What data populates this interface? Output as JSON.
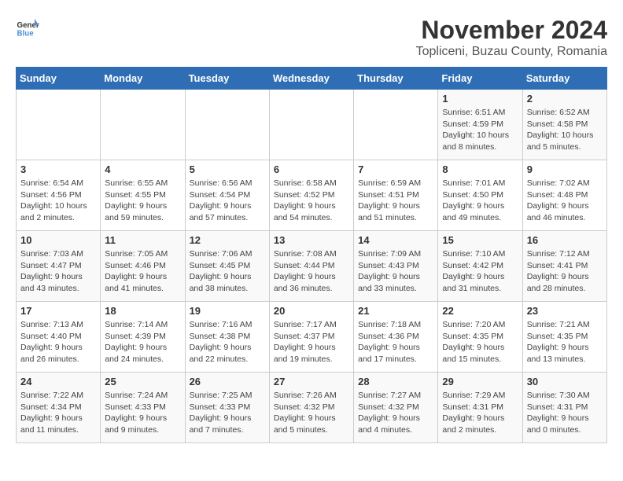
{
  "header": {
    "logo_general": "General",
    "logo_blue": "Blue",
    "month_title": "November 2024",
    "location": "Topliceni, Buzau County, Romania"
  },
  "days_of_week": [
    "Sunday",
    "Monday",
    "Tuesday",
    "Wednesday",
    "Thursday",
    "Friday",
    "Saturday"
  ],
  "weeks": [
    {
      "days": [
        {
          "number": "",
          "info": ""
        },
        {
          "number": "",
          "info": ""
        },
        {
          "number": "",
          "info": ""
        },
        {
          "number": "",
          "info": ""
        },
        {
          "number": "",
          "info": ""
        },
        {
          "number": "1",
          "info": "Sunrise: 6:51 AM\nSunset: 4:59 PM\nDaylight: 10 hours and 8 minutes."
        },
        {
          "number": "2",
          "info": "Sunrise: 6:52 AM\nSunset: 4:58 PM\nDaylight: 10 hours and 5 minutes."
        }
      ]
    },
    {
      "days": [
        {
          "number": "3",
          "info": "Sunrise: 6:54 AM\nSunset: 4:56 PM\nDaylight: 10 hours and 2 minutes."
        },
        {
          "number": "4",
          "info": "Sunrise: 6:55 AM\nSunset: 4:55 PM\nDaylight: 9 hours and 59 minutes."
        },
        {
          "number": "5",
          "info": "Sunrise: 6:56 AM\nSunset: 4:54 PM\nDaylight: 9 hours and 57 minutes."
        },
        {
          "number": "6",
          "info": "Sunrise: 6:58 AM\nSunset: 4:52 PM\nDaylight: 9 hours and 54 minutes."
        },
        {
          "number": "7",
          "info": "Sunrise: 6:59 AM\nSunset: 4:51 PM\nDaylight: 9 hours and 51 minutes."
        },
        {
          "number": "8",
          "info": "Sunrise: 7:01 AM\nSunset: 4:50 PM\nDaylight: 9 hours and 49 minutes."
        },
        {
          "number": "9",
          "info": "Sunrise: 7:02 AM\nSunset: 4:48 PM\nDaylight: 9 hours and 46 minutes."
        }
      ]
    },
    {
      "days": [
        {
          "number": "10",
          "info": "Sunrise: 7:03 AM\nSunset: 4:47 PM\nDaylight: 9 hours and 43 minutes."
        },
        {
          "number": "11",
          "info": "Sunrise: 7:05 AM\nSunset: 4:46 PM\nDaylight: 9 hours and 41 minutes."
        },
        {
          "number": "12",
          "info": "Sunrise: 7:06 AM\nSunset: 4:45 PM\nDaylight: 9 hours and 38 minutes."
        },
        {
          "number": "13",
          "info": "Sunrise: 7:08 AM\nSunset: 4:44 PM\nDaylight: 9 hours and 36 minutes."
        },
        {
          "number": "14",
          "info": "Sunrise: 7:09 AM\nSunset: 4:43 PM\nDaylight: 9 hours and 33 minutes."
        },
        {
          "number": "15",
          "info": "Sunrise: 7:10 AM\nSunset: 4:42 PM\nDaylight: 9 hours and 31 minutes."
        },
        {
          "number": "16",
          "info": "Sunrise: 7:12 AM\nSunset: 4:41 PM\nDaylight: 9 hours and 28 minutes."
        }
      ]
    },
    {
      "days": [
        {
          "number": "17",
          "info": "Sunrise: 7:13 AM\nSunset: 4:40 PM\nDaylight: 9 hours and 26 minutes."
        },
        {
          "number": "18",
          "info": "Sunrise: 7:14 AM\nSunset: 4:39 PM\nDaylight: 9 hours and 24 minutes."
        },
        {
          "number": "19",
          "info": "Sunrise: 7:16 AM\nSunset: 4:38 PM\nDaylight: 9 hours and 22 minutes."
        },
        {
          "number": "20",
          "info": "Sunrise: 7:17 AM\nSunset: 4:37 PM\nDaylight: 9 hours and 19 minutes."
        },
        {
          "number": "21",
          "info": "Sunrise: 7:18 AM\nSunset: 4:36 PM\nDaylight: 9 hours and 17 minutes."
        },
        {
          "number": "22",
          "info": "Sunrise: 7:20 AM\nSunset: 4:35 PM\nDaylight: 9 hours and 15 minutes."
        },
        {
          "number": "23",
          "info": "Sunrise: 7:21 AM\nSunset: 4:35 PM\nDaylight: 9 hours and 13 minutes."
        }
      ]
    },
    {
      "days": [
        {
          "number": "24",
          "info": "Sunrise: 7:22 AM\nSunset: 4:34 PM\nDaylight: 9 hours and 11 minutes."
        },
        {
          "number": "25",
          "info": "Sunrise: 7:24 AM\nSunset: 4:33 PM\nDaylight: 9 hours and 9 minutes."
        },
        {
          "number": "26",
          "info": "Sunrise: 7:25 AM\nSunset: 4:33 PM\nDaylight: 9 hours and 7 minutes."
        },
        {
          "number": "27",
          "info": "Sunrise: 7:26 AM\nSunset: 4:32 PM\nDaylight: 9 hours and 5 minutes."
        },
        {
          "number": "28",
          "info": "Sunrise: 7:27 AM\nSunset: 4:32 PM\nDaylight: 9 hours and 4 minutes."
        },
        {
          "number": "29",
          "info": "Sunrise: 7:29 AM\nSunset: 4:31 PM\nDaylight: 9 hours and 2 minutes."
        },
        {
          "number": "30",
          "info": "Sunrise: 7:30 AM\nSunset: 4:31 PM\nDaylight: 9 hours and 0 minutes."
        }
      ]
    }
  ]
}
